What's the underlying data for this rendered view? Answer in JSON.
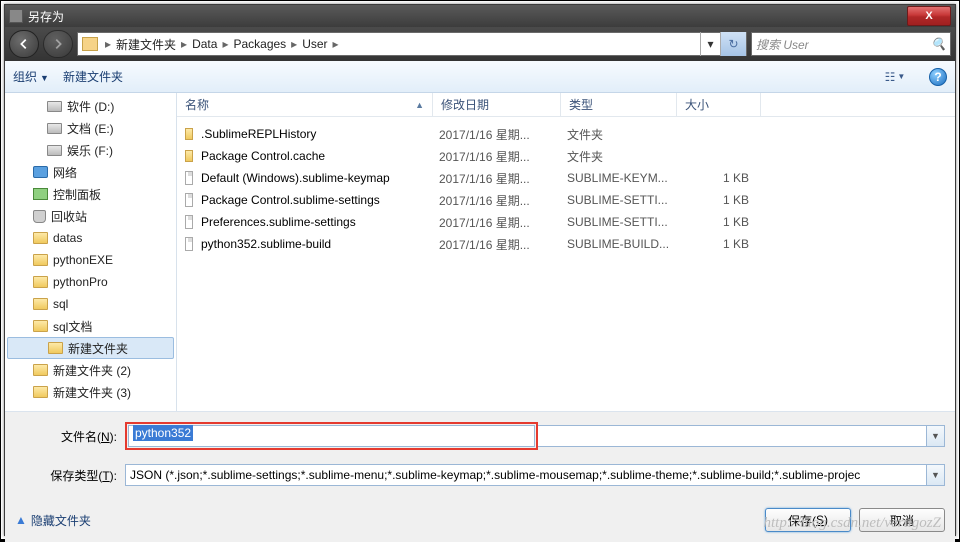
{
  "title": "另存为",
  "close_x": "X",
  "breadcrumb": {
    "seg1": "新建文件夹",
    "seg2": "Data",
    "seg3": "Packages",
    "seg4": "User"
  },
  "search": {
    "placeholder": "搜索 User"
  },
  "toolbar": {
    "organize": "组织",
    "new_folder": "新建文件夹"
  },
  "sidebar": [
    {
      "label": "软件 (D:)",
      "type": "drive",
      "indent": 2
    },
    {
      "label": "文档 (E:)",
      "type": "drive",
      "indent": 2
    },
    {
      "label": "娱乐 (F:)",
      "type": "drive",
      "indent": 2
    },
    {
      "label": "网络",
      "type": "net",
      "indent": 1
    },
    {
      "label": "控制面板",
      "type": "cp",
      "indent": 1
    },
    {
      "label": "回收站",
      "type": "bin",
      "indent": 1
    },
    {
      "label": "datas",
      "type": "folder",
      "indent": 1
    },
    {
      "label": "pythonEXE",
      "type": "folder",
      "indent": 1
    },
    {
      "label": "pythonPro",
      "type": "folder",
      "indent": 1
    },
    {
      "label": "sql",
      "type": "folder",
      "indent": 1
    },
    {
      "label": "sql文档",
      "type": "folder",
      "indent": 1
    },
    {
      "label": "新建文件夹",
      "type": "folder",
      "indent": 1,
      "selected": true
    },
    {
      "label": "新建文件夹 (2)",
      "type": "folder",
      "indent": 1
    },
    {
      "label": "新建文件夹 (3)",
      "type": "folder",
      "indent": 1
    }
  ],
  "columns": {
    "name": "名称",
    "date": "修改日期",
    "type": "类型",
    "size": "大小"
  },
  "files": [
    {
      "name": ".SublimeREPLHistory",
      "date": "2017/1/16 星期...",
      "type": "文件夹",
      "size": "",
      "icon": "folder"
    },
    {
      "name": "Package Control.cache",
      "date": "2017/1/16 星期...",
      "type": "文件夹",
      "size": "",
      "icon": "folder"
    },
    {
      "name": "Default (Windows).sublime-keymap",
      "date": "2017/1/16 星期...",
      "type": "SUBLIME-KEYM...",
      "size": "1 KB",
      "icon": "doc"
    },
    {
      "name": "Package Control.sublime-settings",
      "date": "2017/1/16 星期...",
      "type": "SUBLIME-SETTI...",
      "size": "1 KB",
      "icon": "doc"
    },
    {
      "name": "Preferences.sublime-settings",
      "date": "2017/1/16 星期...",
      "type": "SUBLIME-SETTI...",
      "size": "1 KB",
      "icon": "doc"
    },
    {
      "name": "python352.sublime-build",
      "date": "2017/1/16 星期...",
      "type": "SUBLIME-BUILD...",
      "size": "1 KB",
      "icon": "doc"
    }
  ],
  "form": {
    "filename_label": "文件名(N):",
    "filename_label_pre": "文件名(",
    "filename_label_key": "N",
    "filename_label_post": "):",
    "filename_value": "python352",
    "filetype_label_pre": "保存类型(",
    "filetype_label_key": "T",
    "filetype_label_post": "):",
    "filetype_value": "JSON (*.json;*.sublime-settings;*.sublime-menu;*.sublime-keymap;*.sublime-mousemap;*.sublime-theme;*.sublime-build;*.sublime-projec"
  },
  "actions": {
    "hide_folders": "隐藏文件夹",
    "save_pre": "保存(",
    "save_key": "S",
    "save_post": ")",
    "cancel": "取消"
  },
  "watermark": "http://blog.csdn.net/vertigozZ"
}
